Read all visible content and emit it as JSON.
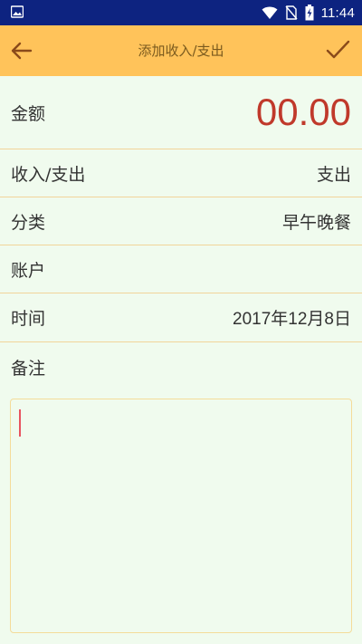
{
  "status_bar": {
    "time": "11:44",
    "icons": [
      "image-icon",
      "wifi-icon",
      "no-sim-icon",
      "battery-charging-icon"
    ]
  },
  "app_bar": {
    "title": "添加收入/支出",
    "back_icon": "arrow-left-icon",
    "confirm_icon": "check-icon"
  },
  "form": {
    "amount": {
      "label": "金额",
      "value": "00.00"
    },
    "type": {
      "label": "收入/支出",
      "value": "支出"
    },
    "category": {
      "label": "分类",
      "value": "早午晚餐"
    },
    "account": {
      "label": "账户",
      "value": ""
    },
    "time": {
      "label": "时间",
      "value": "2017年12月8日"
    },
    "notes": {
      "label": "备注",
      "value": ""
    }
  },
  "colors": {
    "status_bar": "#0d2380",
    "app_bar": "#ffc35a",
    "background": "#f0fbee",
    "divider": "#f1d49a",
    "amount_text": "#c0392b",
    "caret": "#e8545f"
  }
}
